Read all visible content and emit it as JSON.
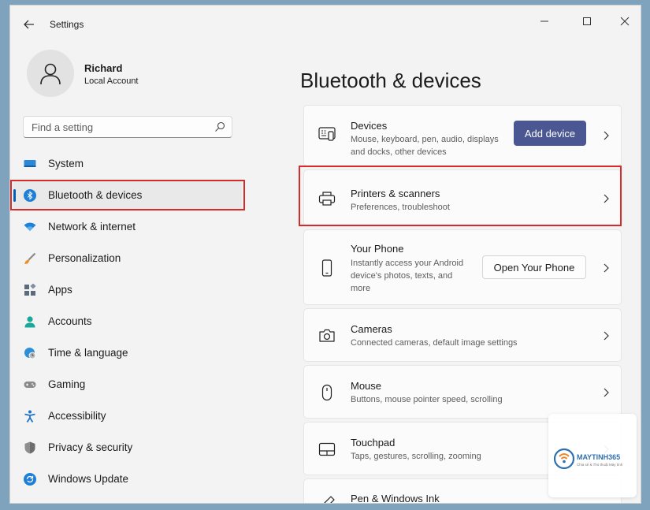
{
  "window": {
    "title": "Settings"
  },
  "colors": {
    "accent": "#005fb8",
    "primary_button": "#4a5793",
    "highlight": "#d72a2a"
  },
  "profile": {
    "name": "Richard",
    "account_type": "Local Account"
  },
  "search": {
    "placeholder": "Find a setting"
  },
  "sidebar": {
    "items": [
      {
        "label": "System",
        "icon": "monitor-icon"
      },
      {
        "label": "Bluetooth & devices",
        "icon": "bluetooth-icon",
        "active": true
      },
      {
        "label": "Network & internet",
        "icon": "wifi-icon"
      },
      {
        "label": "Personalization",
        "icon": "brush-icon"
      },
      {
        "label": "Apps",
        "icon": "apps-icon"
      },
      {
        "label": "Accounts",
        "icon": "person-icon"
      },
      {
        "label": "Time & language",
        "icon": "clock-globe-icon"
      },
      {
        "label": "Gaming",
        "icon": "gamepad-icon"
      },
      {
        "label": "Accessibility",
        "icon": "accessibility-icon"
      },
      {
        "label": "Privacy & security",
        "icon": "shield-icon"
      },
      {
        "label": "Windows Update",
        "icon": "update-icon"
      }
    ]
  },
  "main": {
    "title": "Bluetooth & devices",
    "cards": [
      {
        "title": "Devices",
        "subtitle": "Mouse, keyboard, pen, audio, displays and docks, other devices",
        "button": "Add device",
        "icon": "devices-icon"
      },
      {
        "title": "Printers & scanners",
        "subtitle": "Preferences, troubleshoot",
        "icon": "printer-icon"
      },
      {
        "title": "Your Phone",
        "subtitle": "Instantly access your Android device's photos, texts, and more",
        "button": "Open Your Phone",
        "icon": "phone-icon"
      },
      {
        "title": "Cameras",
        "subtitle": "Connected cameras, default image settings",
        "icon": "camera-icon"
      },
      {
        "title": "Mouse",
        "subtitle": "Buttons, mouse pointer speed, scrolling",
        "icon": "mouse-icon"
      },
      {
        "title": "Touchpad",
        "subtitle": "Taps, gestures, scrolling, zooming",
        "icon": "touchpad-icon"
      },
      {
        "title": "Pen & Windows Ink",
        "icon": "pen-icon"
      }
    ]
  },
  "watermark": {
    "brand": "MAYTINH365",
    "tagline": "Chia sẻ & Thủ thuật Máy tính"
  }
}
